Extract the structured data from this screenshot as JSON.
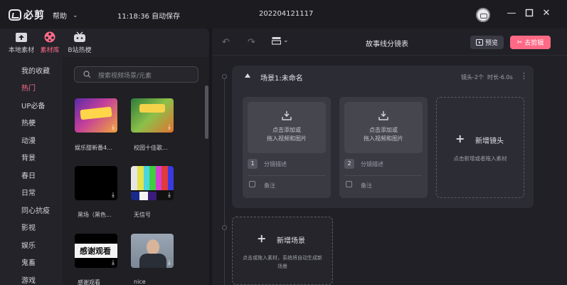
{
  "app": {
    "logo_text": "必剪",
    "help_label": "帮助",
    "save_status": "11:18:36 自动保存",
    "project_name": "202204121117"
  },
  "left_tabs": [
    {
      "label": "本地素材",
      "icon": "upload-icon"
    },
    {
      "label": "素材库",
      "icon": "film-reel-icon"
    },
    {
      "label": "B站热梗",
      "icon": "bilibili-tv-icon"
    }
  ],
  "categories": [
    "我的收藏",
    "热门",
    "UP必备",
    "热梗",
    "动漫",
    "背景",
    "春日",
    "日常",
    "同心抗疫",
    "影视",
    "娱乐",
    "鬼畜",
    "游戏"
  ],
  "active_category": "热门",
  "search": {
    "placeholder": "搜索视频场景/元素"
  },
  "materials": [
    {
      "label": "娱乐甜新番4...",
      "overlay": ""
    },
    {
      "label": "校园十佳歌...",
      "overlay": ""
    },
    {
      "label": "黑场（黑色...",
      "overlay": ""
    },
    {
      "label": "无信号",
      "overlay": ""
    },
    {
      "label": "感谢观看",
      "overlay": "感谢观看"
    },
    {
      "label": "nice",
      "overlay": ""
    }
  ],
  "toolbar": {
    "title": "故事线分镜表",
    "preview_label": "预览",
    "cut_label": "去剪辑"
  },
  "scene": {
    "title": "场景1:未命名",
    "shot_count": "镜头-2个",
    "duration": "时长-6.0s"
  },
  "shots": [
    {
      "number": "1",
      "drop_line1": "点击添加或",
      "drop_line2": "拖入视频和图片",
      "desc": "分镜描述",
      "note": "备注"
    },
    {
      "number": "2",
      "drop_line1": "点击添加或",
      "drop_line2": "拖入视频和图片",
      "desc": "分镜描述",
      "note": "备注"
    }
  ],
  "add_shot": {
    "label": "新增镜头",
    "hint": "点击新增或者拖入素材"
  },
  "add_scene": {
    "label": "新增场景",
    "hint_line1": "点击或拖入素材，系统将自动生成新",
    "hint_line2": "场景"
  },
  "colors": {
    "accent": "#fe6a86",
    "active_text": "#ff6c8a"
  }
}
